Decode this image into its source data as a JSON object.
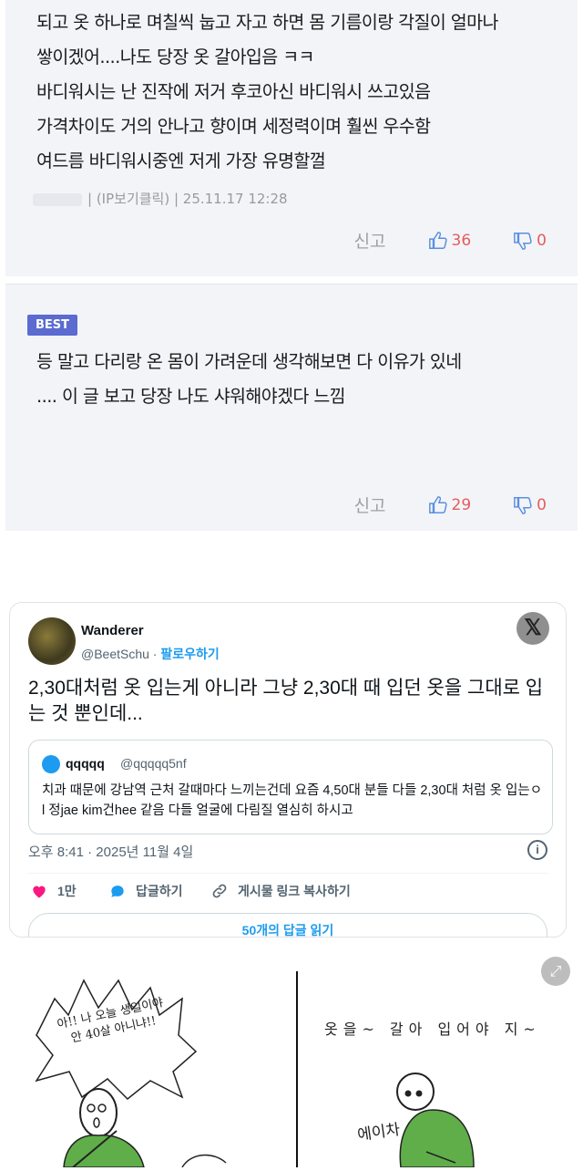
{
  "comment1": {
    "text": "되고 옷 하나로 며칠씩 눕고 자고 하면 몸 기름이랑 각질이 얼마나\n쌓이겠어....나도 당장 옷 갈아입음 ㅋㅋ\n바디워시는 난 진작에 저거 후코아신 바디워시 쓰고있음\n가격차이도 거의 안나고  향이며 세정력이며 훨씬  우수함\n여드름 바디워시중엔 저게 가장 유명할껄",
    "meta": "| (IP보기클릭) | 25.11.17 12:28",
    "report": "신고",
    "likes": "36",
    "dislikes": "0"
  },
  "comment2": {
    "badge": "BEST",
    "text": "등 말고 다리랑 온 몸이 가려운데 생각해보면 다 이유가 있네\n.... 이 글 보고 당장 나도 샤워해야겠다 느낌",
    "report": "신고",
    "likes": "29",
    "dislikes": "0"
  },
  "tweet": {
    "name": "Wanderer",
    "handle": "@BeetSchu · ",
    "follow": "팔로우하기",
    "text": "2,30대처럼 옷 입는게 아니라 그냥 2,30대 때 입던 옷을 그대로 입는 것 뿐인데...",
    "quote": {
      "name": "qqqqq",
      "handle": "@qqqqq5nf",
      "text": "치과 때문에 강남역 근처 갈때마다 느끼는건데 요즘 4,50대 분들 다들 2,30대 처럼 옷 입는ㅇ l 정jae kim건hee 같음 다들 얼굴에 다림질 열심히 하시고"
    },
    "date": "오후 8:41 · 2025년 11월 4일",
    "likes": "1만",
    "reply": "답글하기",
    "copy": "게시물 링크 복사하기",
    "read_replies": "50개의 답글 읽기"
  },
  "comic": {
    "shout": "아!! 나 오늘 생일이야\n안 40살 아니냐!!",
    "caption_top": "옷을~ 갈아 입어야 지~",
    "caption_bottom": "에이차"
  },
  "colors": {
    "best_badge": "#5b6bd0",
    "like_red": "#e35d5d",
    "twitter_blue": "#1d9bf0",
    "heart_pink": "#f91880",
    "comic_green": "#5fae4a"
  }
}
